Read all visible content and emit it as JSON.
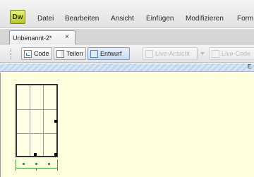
{
  "app": {
    "logo": "Dw"
  },
  "menu": [
    "Datei",
    "Bearbeiten",
    "Ansicht",
    "Einfügen",
    "Modifizieren",
    "Form"
  ],
  "document_tab": {
    "title": "Unbenannt-2*",
    "close": "×"
  },
  "toolbar": {
    "code_label": "Code",
    "split_label": "Teilen",
    "design_label": "Entwurf",
    "live_view_label": "Live-Ansicht",
    "live_code_label": "Live-Code"
  },
  "strip": {
    "letter": "E"
  },
  "colors": {
    "canvas": "#ffffe0",
    "logo": "#c8d238",
    "width_bar": "#3f9d3f"
  }
}
